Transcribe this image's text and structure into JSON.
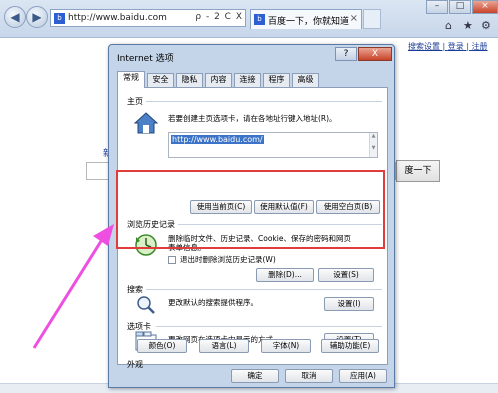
{
  "browser": {
    "url": "http://www.baidu.com",
    "address_tools": "ρ - 2 C X",
    "tab_title": "百度一下，你就知道",
    "tab_close": "×",
    "nav_back": "◀",
    "nav_forward": "▶",
    "window_controls": {
      "minimize": "–",
      "maximize": "□",
      "close": "×"
    },
    "toolbar_icons": {
      "home": "⌂",
      "favorites": "★",
      "tools": "⚙"
    }
  },
  "page": {
    "links": [
      "搜索设置",
      "登录",
      "注册"
    ],
    "link_separator": " | ",
    "search_button": "度一下",
    "left_fragment": "新"
  },
  "dialog": {
    "title": "Internet 选项",
    "help_button": "?",
    "close_button": "X",
    "tabs": [
      "常规",
      "安全",
      "隐私",
      "内容",
      "连接",
      "程序",
      "高级"
    ],
    "active_tab": "常规",
    "homepage": {
      "label": "主页",
      "description": "若要创建主页选项卡，请在各地址行键入地址(R)。",
      "url": "http://www.baidu.com/",
      "buttons": [
        "使用当前页(C)",
        "使用默认值(F)",
        "使用空白页(B)"
      ]
    },
    "history": {
      "label": "浏览历史记录",
      "description_line1": "删除临时文件、历史记录、Cookie、保存的密码和网页",
      "description_line2": "表单信息。",
      "checkbox_label": "退出时删除浏览历史记录(W)",
      "checkbox_checked": false,
      "delete_button": "删除(D)...",
      "settings_button": "设置(S)"
    },
    "search": {
      "label": "搜索",
      "description": "更改默认的搜索提供程序。",
      "settings_button": "设置(I)"
    },
    "tabs_section": {
      "label": "选项卡",
      "description": "更改网页在选项卡中显示的方式。",
      "settings_button": "设置(T)"
    },
    "appearance": {
      "label": "外观",
      "buttons": [
        "颜色(O)",
        "语言(L)",
        "字体(N)",
        "辅助功能(E)"
      ]
    },
    "footer": {
      "ok": "确定",
      "cancel": "取消",
      "apply": "应用(A)"
    }
  },
  "colors": {
    "highlight_box": "#e03c3c",
    "annotation_arrow": "#ee4fe0",
    "selection": "#3a73c8"
  }
}
